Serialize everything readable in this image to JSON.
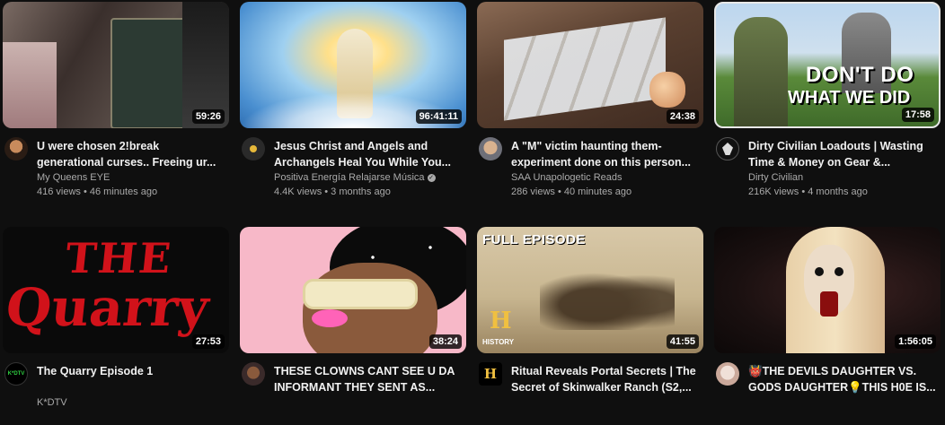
{
  "videos": [
    {
      "title": "U were chosen 2!break\ngenerational curses.. Freeing ur...",
      "channel": "My Queens EYE",
      "views": "416 views",
      "age": "46 minutes ago",
      "duration": "59:26",
      "verified": false
    },
    {
      "title": "Jesus Christ and Angels and\nArchangels Heal You While You...",
      "channel": "Positiva Energía Relajarse Música",
      "views": "4.4K views",
      "age": "3 months ago",
      "duration": "96:41:11",
      "verified": true
    },
    {
      "title": "A \"M\" victim haunting them-\nexperiment done on this person...",
      "channel": "SAA Unapologetic Reads",
      "views": "286 views",
      "age": "40 minutes ago",
      "duration": "24:38",
      "verified": false
    },
    {
      "title": "Dirty Civilian Loadouts | Wasting\nTime & Money on Gear &...",
      "channel": "Dirty Civilian",
      "views": "216K views",
      "age": "4 months ago",
      "duration": "17:58",
      "verified": false
    },
    {
      "title": "The Quarry Episode 1",
      "channel": "K*DTV",
      "duration": "27:53"
    },
    {
      "title": "THESE CLOWNS CANT SEE U DA\nINFORMANT THEY SENT AS...",
      "duration": "38:24"
    },
    {
      "title": "Ritual Reveals Portal Secrets | The\nSecret of Skinwalker Ranch (S2,...",
      "duration": "41:55"
    },
    {
      "title": "👹THE DEVILS DAUGHTER VS.\nGODS DAUGHTER💡THIS H0E IS...",
      "duration": "1:56:05"
    }
  ],
  "thumb_text": {
    "quarry_line1": "THE",
    "quarry_line2": "Quarry",
    "dont_do_line1": "DON'T DO",
    "dont_do_line2": "WHAT WE DID",
    "full_episode": "FULL EPISODE",
    "history": "HISTORY",
    "history_h": "H",
    "kdtv": "K*DTV",
    "history_avatar": "H"
  },
  "colors": {
    "background": "#0f0f0f",
    "title": "#f1f1f1",
    "meta": "#aaaaaa",
    "quarry_red": "#d1121a"
  }
}
